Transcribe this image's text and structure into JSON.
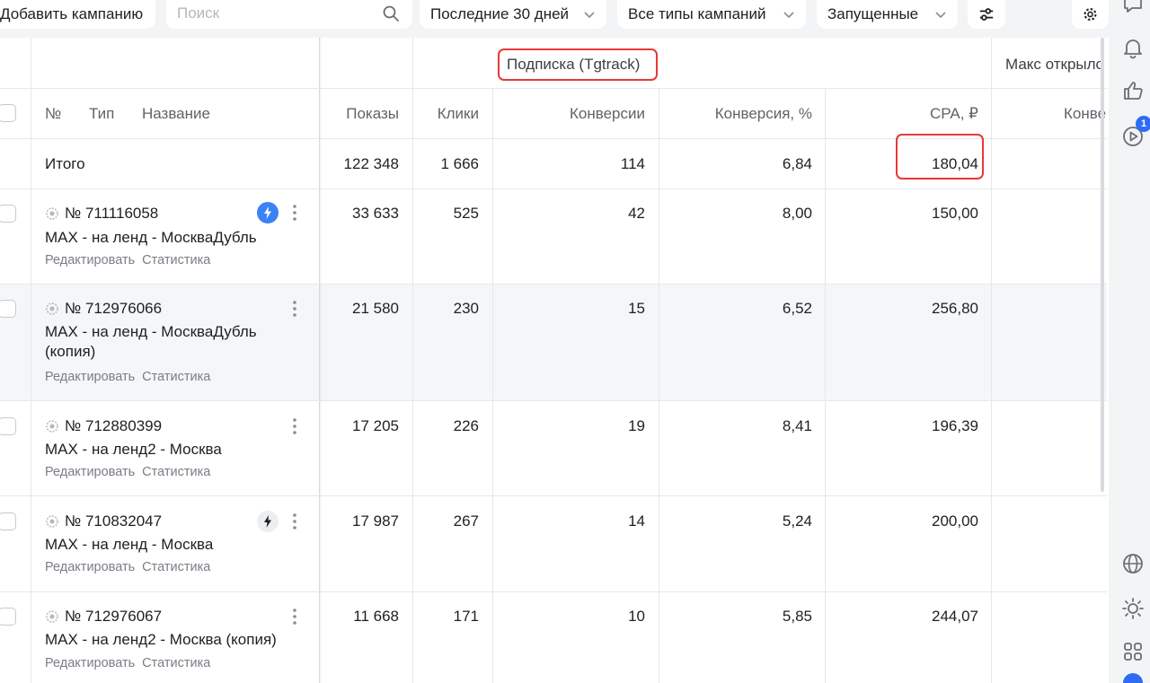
{
  "toolbar": {
    "add_campaign": "Добавить кампанию",
    "search_placeholder": "Поиск",
    "period": "Последние 30 дней",
    "campaign_types": "Все типы кампаний",
    "status": "Запущенные"
  },
  "table": {
    "group_header": "Подписка (Tgtrack)",
    "group_header_2": "Макс открылс",
    "columns": {
      "number": "№",
      "type": "Тип",
      "name": "Название",
      "impressions": "Показы",
      "clicks": "Клики",
      "conversions": "Конверсии",
      "conversion_rate": "Конверсия, %",
      "cpa": "CPA, ₽",
      "conv2": "Конве"
    },
    "total": {
      "label": "Итого",
      "impressions": "122 348",
      "clicks": "1 666",
      "conversions": "114",
      "conversion_rate": "6,84",
      "cpa": "180,04"
    },
    "rows": [
      {
        "id": "№ 711116058",
        "name": "MAX - на ленд - МоскваДубль",
        "impressions": "33 633",
        "clicks": "525",
        "conversions": "42",
        "conversion_rate": "8,00",
        "cpa": "150,00"
      },
      {
        "id": "№ 712976066",
        "name": "MAX - на ленд - МоскваДубль (копия)",
        "impressions": "21 580",
        "clicks": "230",
        "conversions": "15",
        "conversion_rate": "6,52",
        "cpa": "256,80"
      },
      {
        "id": "№ 712880399",
        "name": "MAX - на ленд2 - Москва",
        "impressions": "17 205",
        "clicks": "226",
        "conversions": "19",
        "conversion_rate": "8,41",
        "cpa": "196,39"
      },
      {
        "id": "№ 710832047",
        "name": "MAX - на ленд - Москва",
        "impressions": "17 987",
        "clicks": "267",
        "conversions": "14",
        "conversion_rate": "5,24",
        "cpa": "200,00"
      },
      {
        "id": "№ 712976067",
        "name": "MAX - на ленд2 - Москва (копия)",
        "impressions": "11 668",
        "clicks": "171",
        "conversions": "10",
        "conversion_rate": "5,85",
        "cpa": "244,07"
      }
    ],
    "row_links": {
      "edit": "Редактировать",
      "stats": "Статистика"
    }
  },
  "sidebar": {
    "notification_count": "1",
    "icons": [
      "chat-icon",
      "bell-icon",
      "like-icon",
      "play-icon",
      "globe-icon",
      "sun-icon",
      "apps-icon"
    ]
  },
  "colors": {
    "accent_blue": "#3b82f6",
    "highlight_red": "#e53935",
    "muted_text": "#7a7d85"
  }
}
